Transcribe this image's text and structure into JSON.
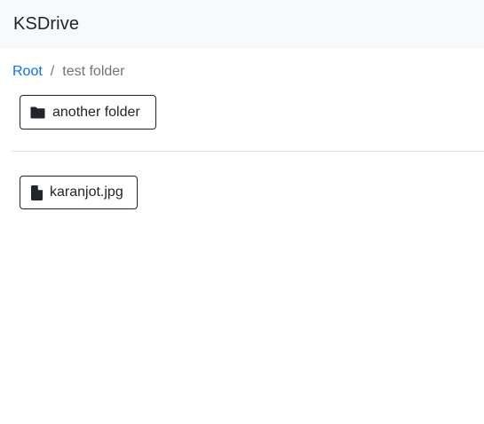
{
  "navbar": {
    "brand": "KSDrive"
  },
  "breadcrumb": {
    "root_label": "Root",
    "separator": "/",
    "current_label": "test folder"
  },
  "folders": [
    {
      "name": "another folder",
      "icon": "folder-icon"
    }
  ],
  "files": [
    {
      "name": "karanjot.jpg",
      "icon": "file-icon"
    }
  ],
  "colors": {
    "navbar_bg": "#f8f9fa",
    "link": "#0d6efd",
    "muted": "#6c757d",
    "text": "#212529",
    "divider": "#dee2e6"
  }
}
